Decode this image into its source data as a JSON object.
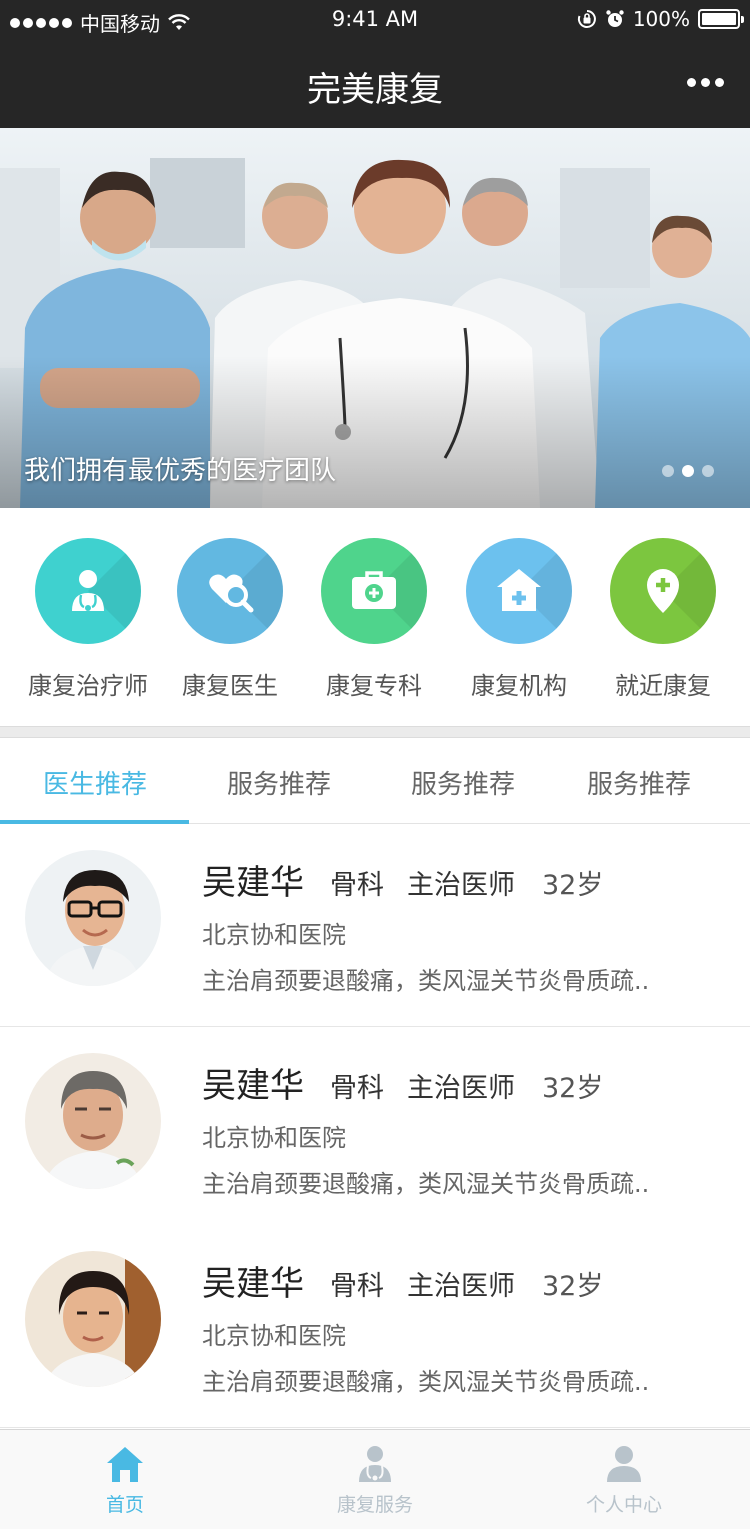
{
  "status_bar": {
    "carrier": "中国移动",
    "time": "9:41 AM",
    "battery": "100%"
  },
  "nav": {
    "title": "完美康复",
    "more_icon": "more-icon"
  },
  "banner": {
    "caption": "我们拥有最优秀的医疗团队",
    "page_count": 3,
    "active_page": 2
  },
  "categories": [
    {
      "label": "康复治疗师",
      "icon": "therapist-icon",
      "color": "#3fd1cf"
    },
    {
      "label": "康复医生",
      "icon": "search-heart-icon",
      "color": "#62b8e1"
    },
    {
      "label": "康复专科",
      "icon": "medical-kit-icon",
      "color": "#4fd48c"
    },
    {
      "label": "康复机构",
      "icon": "hospital-icon",
      "color": "#6cc1ee"
    },
    {
      "label": "就近康复",
      "icon": "location-pin-icon",
      "color": "#7cc63f"
    }
  ],
  "tabs": [
    "医生推荐",
    "服务推荐",
    "服务推荐",
    "服务推荐"
  ],
  "active_tab": 0,
  "doctors": [
    {
      "name": "吴建华",
      "department": "骨科",
      "title": "主治医师",
      "age": "32岁",
      "hospital": "北京协和医院",
      "description": "主治肩颈要退酸痛，类风湿关节炎骨质疏.."
    },
    {
      "name": "吴建华",
      "department": "骨科",
      "title": "主治医师",
      "age": "32岁",
      "hospital": "北京协和医院",
      "description": "主治肩颈要退酸痛，类风湿关节炎骨质疏.."
    },
    {
      "name": "吴建华",
      "department": "骨科",
      "title": "主治医师",
      "age": "32岁",
      "hospital": "北京协和医院",
      "description": "主治肩颈要退酸痛，类风湿关节炎骨质疏.."
    }
  ],
  "tabbar": [
    {
      "label": "首页",
      "icon": "home-icon",
      "active": true
    },
    {
      "label": "康复服务",
      "icon": "rehab-service-icon",
      "active": false
    },
    {
      "label": "个人中心",
      "icon": "user-icon",
      "active": false
    }
  ],
  "colors": {
    "accent": "#49b9e3",
    "header_bg": "#262626"
  }
}
